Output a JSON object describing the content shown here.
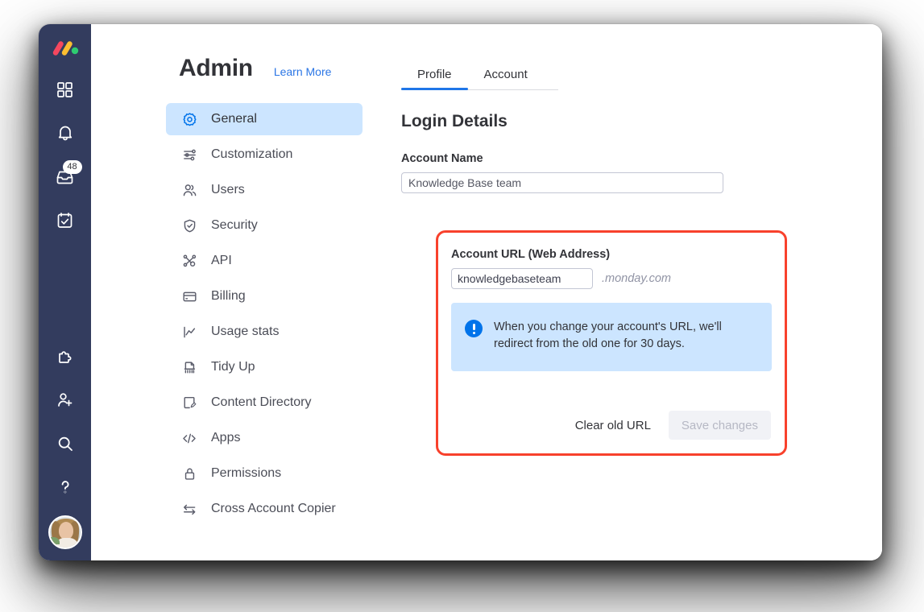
{
  "rail": {
    "logo_name": "monday-logo",
    "items": [
      {
        "name": "apps-grid-icon",
        "label": "Apps grid",
        "badge": null
      },
      {
        "name": "bell-icon",
        "label": "Notifications",
        "badge": null
      },
      {
        "name": "inbox-icon",
        "label": "Inbox",
        "badge": "48"
      },
      {
        "name": "my-work-icon",
        "label": "My work",
        "badge": null
      }
    ],
    "bottom_items": [
      {
        "name": "puzzle-icon",
        "label": "Integrations"
      },
      {
        "name": "invite-user-icon",
        "label": "Invite members"
      },
      {
        "name": "search-icon",
        "label": "Search"
      },
      {
        "name": "help-icon",
        "label": "Help"
      }
    ],
    "avatar_name": "user-avatar"
  },
  "header": {
    "title": "Admin",
    "learn_more": "Learn More"
  },
  "nav": {
    "items": [
      {
        "label": "General",
        "icon": "gear-icon",
        "active": true
      },
      {
        "label": "Customization",
        "icon": "sliders-icon",
        "active": false
      },
      {
        "label": "Users",
        "icon": "users-icon",
        "active": false
      },
      {
        "label": "Security",
        "icon": "shield-check-icon",
        "active": false
      },
      {
        "label": "API",
        "icon": "api-nodes-icon",
        "active": false
      },
      {
        "label": "Billing",
        "icon": "credit-card-icon",
        "active": false
      },
      {
        "label": "Usage stats",
        "icon": "chart-line-icon",
        "active": false
      },
      {
        "label": "Tidy Up",
        "icon": "broom-icon",
        "active": false
      },
      {
        "label": "Content Directory",
        "icon": "document-edit-icon",
        "active": false
      },
      {
        "label": "Apps",
        "icon": "code-brackets-icon",
        "active": false
      },
      {
        "label": "Permissions",
        "icon": "lock-icon",
        "active": false
      },
      {
        "label": "Cross Account Copier",
        "icon": "transfer-arrows-icon",
        "active": false
      }
    ]
  },
  "panel": {
    "tabs": [
      {
        "label": "Profile",
        "active": true
      },
      {
        "label": "Account",
        "active": false
      }
    ],
    "section_title": "Login Details",
    "account_name": {
      "label": "Account Name",
      "value": "Knowledge Base team",
      "placeholder": "Account name"
    },
    "account_url": {
      "label": "Account URL (Web Address)",
      "value": "knowledgebaseteam",
      "placeholder": "account-url",
      "suffix": ".monday.com",
      "notice": {
        "icon": "info-exclamation-icon",
        "text": "When you change your account's URL, we'll redirect from the old one for 30 days."
      },
      "clear_label": "Clear old URL",
      "save_label": "Save changes"
    }
  },
  "colors": {
    "rail_bg": "#333C5E",
    "accent_blue": "#0073EA",
    "link_blue": "#2B76E5",
    "highlight_red": "#F8412C",
    "notice_bg": "#CCE5FF",
    "active_nav_bg": "#CCE5FF"
  }
}
